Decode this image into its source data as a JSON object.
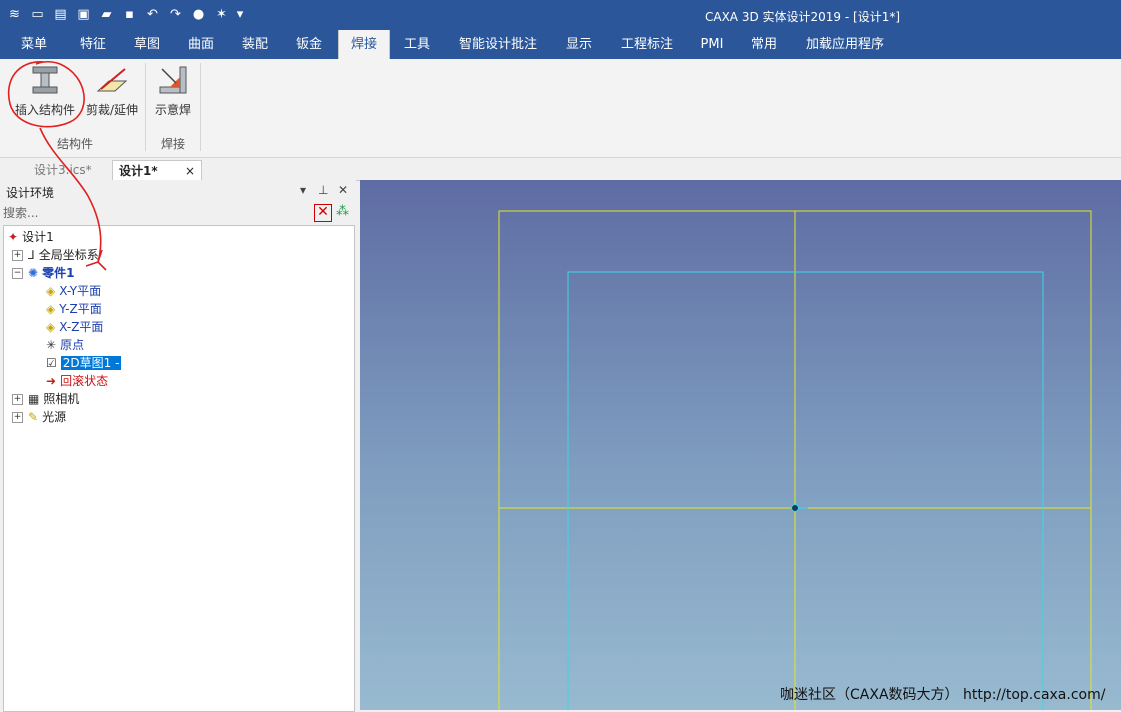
{
  "app": {
    "window_title": "CAXA 3D 实体设计2019 - [设计1*]"
  },
  "quick_access": [
    "app-menu-icon",
    "new-icon",
    "open-icon",
    "import-icon",
    "folder-icon",
    "save-icon",
    "undo-icon",
    "redo-icon",
    "render-icon",
    "sparkle-icon",
    "dropdown-icon"
  ],
  "menu": {
    "tabs": [
      "菜单",
      "特征",
      "草图",
      "曲面",
      "装配",
      "钣金",
      "焊接",
      "工具",
      "智能设计批注",
      "显示",
      "工程标注",
      "PMI",
      "常用",
      "加载应用程序"
    ],
    "active_tab": "焊接"
  },
  "ribbon": {
    "buttons": {
      "insert_structure": "插入结构件",
      "trim_extend": "剪裁/延伸",
      "weld_indicate": "示意焊"
    },
    "groups": {
      "structure": "结构件",
      "weld": "焊接"
    }
  },
  "doc_tabs": [
    {
      "label": "设计3.ics*",
      "active": false
    },
    {
      "label": "设计1*",
      "active": true
    }
  ],
  "panel": {
    "title": "设计环境",
    "search_placeholder": "搜索..."
  },
  "tree": {
    "root": "设计1",
    "global_coords": "全局坐标系",
    "part": "零件1",
    "xy_plane": "X-Y平面",
    "yz_plane": "Y-Z平面",
    "xz_plane": "X-Z平面",
    "origin": "原点",
    "sketch": "2D草图1 -",
    "rollback": "回滚状态",
    "camera": "照相机",
    "light": "光源"
  },
  "watermark": "咖迷社区（CAXA数码大方） http://top.caxa.com/",
  "colors": {
    "title_bar": "#2b579a",
    "sketch_frame": "#e6e620",
    "sketch_inner": "#37d8e6",
    "rollback_text": "#cc1010",
    "part_text": "#1a3fb0",
    "annotation_red": "#e02020"
  }
}
